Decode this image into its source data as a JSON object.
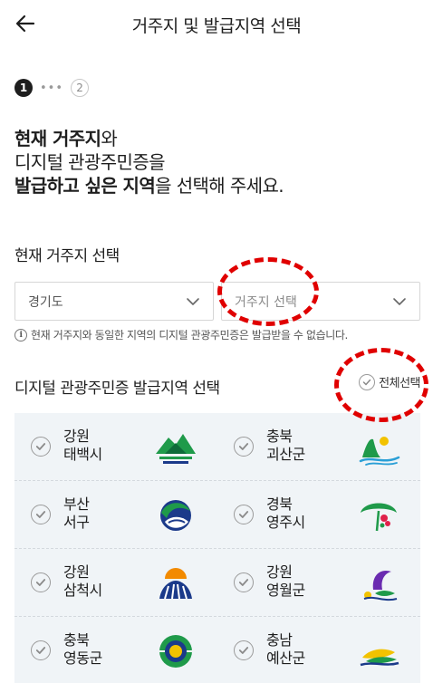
{
  "header": {
    "title": "거주지 및 발급지역 선택"
  },
  "stepper": {
    "step1": "1",
    "step2": "2",
    "dots": "•••"
  },
  "intro": {
    "line1_bold": "현재 거주지",
    "line1_rest": "와",
    "line2": "디지털 관광주민증을",
    "line3_bold": "발급하고 싶은 지역",
    "line3_rest": "을 선택해 주세요."
  },
  "residence": {
    "title": "현재 거주지 선택",
    "province_value": "경기도",
    "city_placeholder": "거주지 선택",
    "notice": "현재 거주지와 동일한 지역의 디지털 관광주민증은 발급받을 수 없습니다."
  },
  "issuance": {
    "title": "디지털 관광주민증 발급지역 선택",
    "select_all": "전체선택",
    "regions": [
      {
        "province": "강원",
        "city": "태백시",
        "logo": "taebaek-mountain-logo"
      },
      {
        "province": "충북",
        "city": "괴산군",
        "logo": "goesan-mountain-logo"
      },
      {
        "province": "부산",
        "city": "서구",
        "logo": "seogu-swirl-logo"
      },
      {
        "province": "경북",
        "city": "영주시",
        "logo": "yeongju-tree-logo"
      },
      {
        "province": "강원",
        "city": "삼척시",
        "logo": "samcheok-sunrise-logo"
      },
      {
        "province": "강원",
        "city": "영월군",
        "logo": "yeongwol-river-logo"
      },
      {
        "province": "충북",
        "city": "영동군",
        "logo": "yeongdong-circle-logo"
      },
      {
        "province": "충남",
        "city": "예산군",
        "logo": "yesan-hill-logo"
      }
    ]
  },
  "colors": {
    "check": "#9a9a9a",
    "panel": "#f0f4f7",
    "annotation": "#e00000",
    "green": "#1f9a4a",
    "navy": "#1b3a8a",
    "yellow": "#f2c200"
  }
}
